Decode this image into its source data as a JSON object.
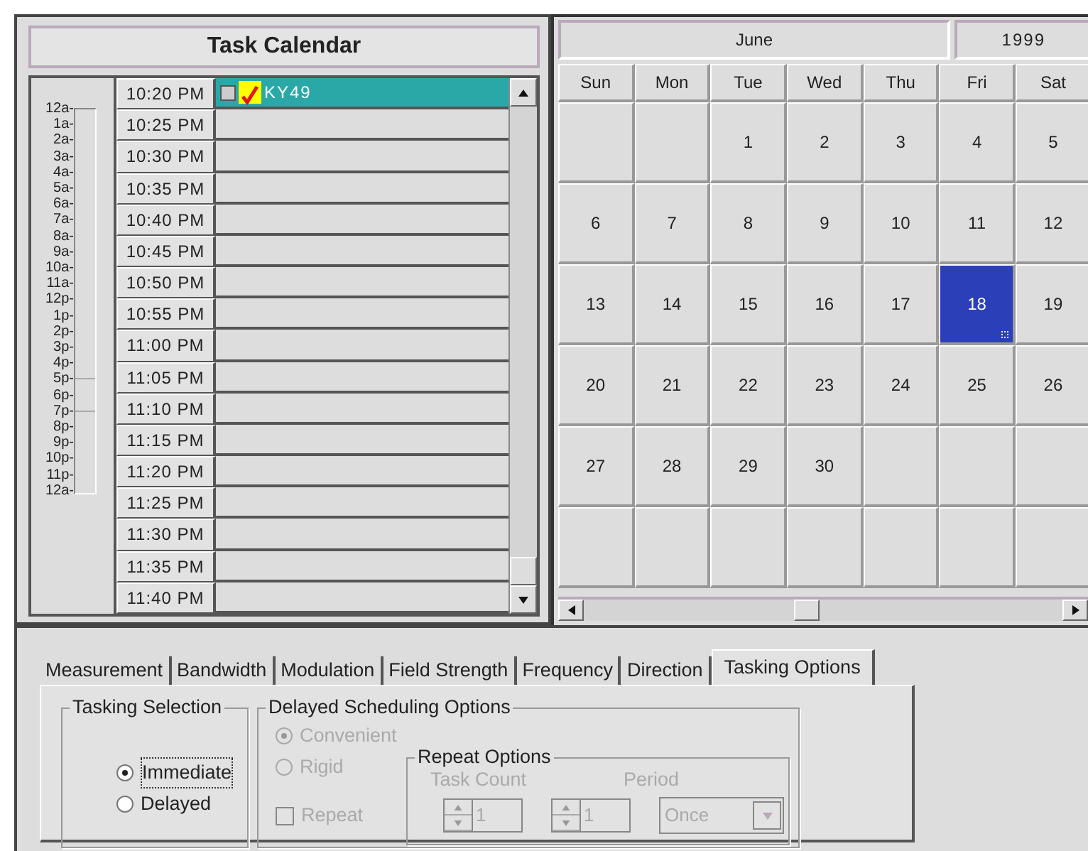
{
  "task_calendar": {
    "title": "Task Calendar",
    "hour_ruler": [
      "12a-",
      "1a-",
      "2a-",
      "3a-",
      "4a-",
      "5a-",
      "6a-",
      "7a-",
      "8a-",
      "9a-",
      "10a-",
      "11a-",
      "12p-",
      "1p-",
      "2p-",
      "3p-",
      "4p-",
      "5p-",
      "6p-",
      "7p-",
      "8p-",
      "9p-",
      "10p-",
      "11p-",
      "12a-"
    ],
    "slots": [
      {
        "time": "10:20 PM",
        "selected": true,
        "task": {
          "label": "KY49",
          "checked": false
        }
      },
      {
        "time": "10:25 PM",
        "selected": false
      },
      {
        "time": "10:30 PM",
        "selected": false
      },
      {
        "time": "10:35 PM",
        "selected": false
      },
      {
        "time": "10:40 PM",
        "selected": false
      },
      {
        "time": "10:45 PM",
        "selected": false
      },
      {
        "time": "10:50 PM",
        "selected": false
      },
      {
        "time": "10:55 PM",
        "selected": false
      },
      {
        "time": "11:00 PM",
        "selected": false
      },
      {
        "time": "11:05 PM",
        "selected": false
      },
      {
        "time": "11:10 PM",
        "selected": false
      },
      {
        "time": "11:15 PM",
        "selected": false
      },
      {
        "time": "11:20 PM",
        "selected": false
      },
      {
        "time": "11:25 PM",
        "selected": false
      },
      {
        "time": "11:30 PM",
        "selected": false
      },
      {
        "time": "11:35 PM",
        "selected": false
      },
      {
        "time": "11:40 PM",
        "selected": false
      }
    ]
  },
  "month_calendar": {
    "month": "June",
    "year": "1999",
    "weekdays": [
      "Sun",
      "Mon",
      "Tue",
      "Wed",
      "Thu",
      "Fri",
      "Sat"
    ],
    "weeks": [
      [
        {
          "selected": false
        },
        {
          "selected": false
        },
        {
          "day": "1",
          "selected": false
        },
        {
          "day": "2",
          "selected": false
        },
        {
          "day": "3",
          "selected": false
        },
        {
          "day": "4",
          "selected": false
        },
        {
          "day": "5",
          "selected": false
        }
      ],
      [
        {
          "day": "6",
          "selected": false
        },
        {
          "day": "7",
          "selected": false
        },
        {
          "day": "8",
          "selected": false
        },
        {
          "day": "9",
          "selected": false
        },
        {
          "day": "10",
          "selected": false
        },
        {
          "day": "11",
          "selected": false
        },
        {
          "day": "12",
          "selected": false
        }
      ],
      [
        {
          "day": "13",
          "selected": false
        },
        {
          "day": "14",
          "selected": false
        },
        {
          "day": "15",
          "selected": false
        },
        {
          "day": "16",
          "selected": false
        },
        {
          "day": "17",
          "selected": false
        },
        {
          "day": "18",
          "selected": true
        },
        {
          "day": "19",
          "selected": false
        }
      ],
      [
        {
          "day": "20",
          "selected": false
        },
        {
          "day": "21",
          "selected": false
        },
        {
          "day": "22",
          "selected": false
        },
        {
          "day": "23",
          "selected": false
        },
        {
          "day": "24",
          "selected": false
        },
        {
          "day": "25",
          "selected": false
        },
        {
          "day": "26",
          "selected": false
        }
      ],
      [
        {
          "day": "27",
          "selected": false
        },
        {
          "day": "28",
          "selected": false
        },
        {
          "day": "29",
          "selected": false
        },
        {
          "day": "30",
          "selected": false
        },
        {
          "selected": false
        },
        {
          "selected": false
        },
        {
          "selected": false
        }
      ],
      [
        {
          "selected": false
        },
        {
          "selected": false
        },
        {
          "selected": false
        },
        {
          "selected": false
        },
        {
          "selected": false
        },
        {
          "selected": false
        },
        {
          "selected": false
        }
      ]
    ]
  },
  "tabs": [
    {
      "label": "Measurement",
      "selected": false
    },
    {
      "label": "Bandwidth",
      "selected": false
    },
    {
      "label": "Modulation",
      "selected": false
    },
    {
      "label": "Field Strength",
      "selected": false
    },
    {
      "label": "Frequency",
      "selected": false
    },
    {
      "label": "Direction",
      "selected": false
    },
    {
      "label": "Tasking Options",
      "selected": true
    }
  ],
  "tasking_selection": {
    "title": "Tasking Selection",
    "options": [
      {
        "label": "Immediate",
        "selected": true
      },
      {
        "label": "Delayed",
        "selected": false
      }
    ]
  },
  "delayed_scheduling": {
    "title": "Delayed Scheduling Options",
    "disabled": true,
    "options": [
      {
        "label": "Convenient",
        "selected": true
      },
      {
        "label": "Rigid",
        "selected": false
      }
    ],
    "repeat": {
      "label": "Repeat",
      "checked": false
    },
    "repeat_options": {
      "title": "Repeat Options",
      "task_count_label": "Task Count",
      "period_label": "Period",
      "task_count": "1",
      "period": "1",
      "period_unit": "Once"
    }
  }
}
